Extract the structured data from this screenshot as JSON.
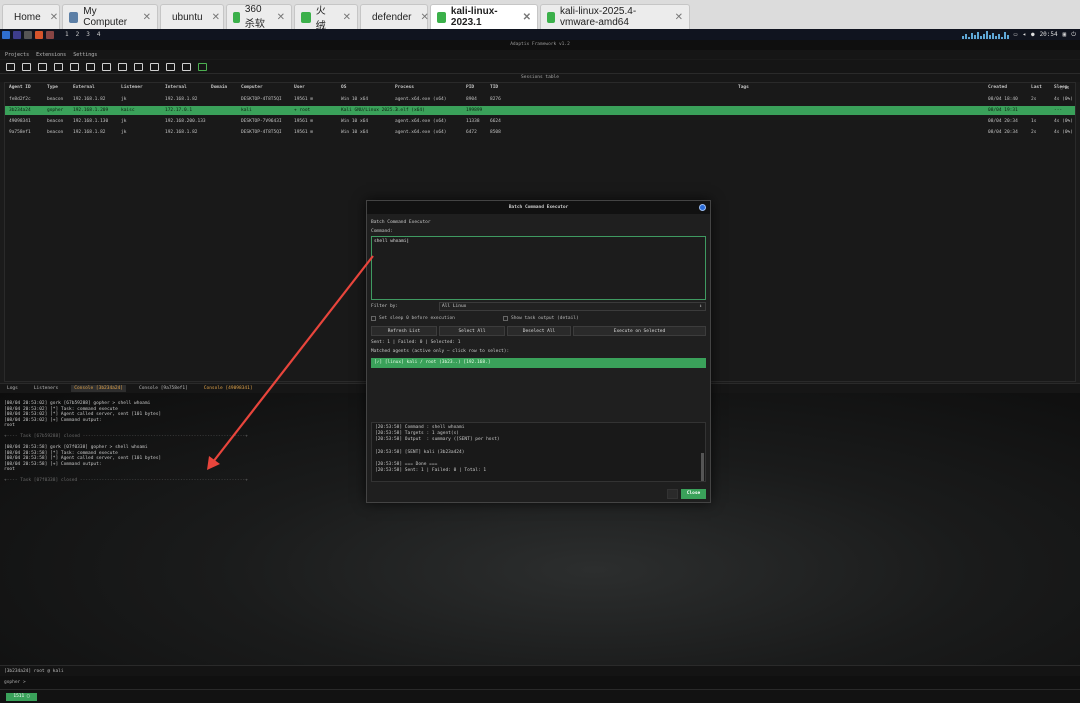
{
  "browser_tabs": [
    {
      "label": "Home",
      "color": "#4a86d8"
    },
    {
      "label": "My Computer",
      "color": "#5c7fa6"
    },
    {
      "label": "ubuntu",
      "color": "#6a8aa8"
    },
    {
      "label": "360杀软",
      "color": "#3bb04a"
    },
    {
      "label": "火绒",
      "color": "#3bb04a"
    },
    {
      "label": "defender",
      "color": "#3bb04a"
    },
    {
      "label": "kali-linux-2023.1",
      "color": "#3bb04a"
    },
    {
      "label": "kali-linux-2025.4-vmware-amd64",
      "color": "#3bb04a"
    }
  ],
  "taskbar": {
    "workspaces": [
      "1",
      "2",
      "3",
      "4"
    ],
    "time": "20:54"
  },
  "app_title": "Adaptix Framework v1.2",
  "menu": [
    "Projects",
    "Extensions",
    "Settings"
  ],
  "sessions": {
    "title": "Sessions table",
    "headers": [
      "Agent ID",
      "Type",
      "External",
      "Listener",
      "Internal",
      "Domain",
      "Computer",
      "User",
      "OS",
      "Process",
      "PID",
      "TID",
      "Tags",
      "Created",
      "Last",
      "Sleep"
    ],
    "rows": [
      [
        "fe8d2f2c",
        "beacon",
        "192.168.1.82",
        "jk",
        "192.168.1.82",
        "",
        "DESKTOP-4T8T5QI",
        "19561 ⊞",
        "Win 10 x64",
        "agent.x64.exe (x64)",
        "8904",
        "8276",
        "",
        "08/04 18:40",
        "2s",
        "4s (0%)"
      ],
      [
        "3b234a24",
        "gopher",
        "192.168.1.209",
        "kaisc",
        "172.17.0.1",
        "",
        "kali",
        "+ root",
        "Kali GNU/Linux 2025.3",
        "3.elf (x64)",
        "199899",
        "",
        "",
        "08/04 19:31",
        "",
        "---"
      ],
      [
        "49098341",
        "beacon",
        "192.168.1.130",
        "jk",
        "192.168.200.133",
        "",
        "DESKTOP-7V9643I",
        "19561 ⊞",
        "Win 10 x64",
        "agent.x64.exe (x64)",
        "11338",
        "6624",
        "",
        "08/04 20:34",
        "1s",
        "4s (0%)"
      ],
      [
        "9a758ef1",
        "beacon",
        "192.168.1.82",
        "jk",
        "192.168.1.82",
        "",
        "DESKTOP-4T8T5QI",
        "19561 ⊞",
        "Win 10 x64",
        "agent.x64.exe (x64)",
        "6472",
        "8508",
        "",
        "08/04 20:34",
        "2s",
        "4s (0%)"
      ]
    ]
  },
  "dialog": {
    "title": "Batch Command Executor",
    "heading": "Batch Command Executor",
    "command_label": "Command:",
    "command_value": "shell whoami",
    "filter_label": "Filter by:",
    "filter_value": "All Linux",
    "sleep_checkbox": "Set sleep 0 before execution",
    "task_output_checkbox": "Show task output (detail)",
    "buttons": {
      "refresh": "Refresh List",
      "select_all": "Select All",
      "deselect_all": "Deselect All",
      "execute": "Execute on Selected",
      "close": "Close"
    },
    "stats": "Sent: 1 | Failed: 0 | Selected: 1",
    "matched_label": "Matched agents (active only — click row to select):",
    "matched_row": "[✓] [linux] kali / root (3b23..)  [192.168.]",
    "log": [
      "[20:53:58] Command : shell whoami",
      "[20:53:58] Targets : 1 agent(s)",
      "[20:53:58] Output  : summary ([SENT] per host)",
      "",
      "[20:53:58] [SENT] kali (3b23a424)",
      "",
      "[20:53:58] === Done ===",
      "[20:53:58] Sent: 1 | Failed: 0 | Total: 1"
    ]
  },
  "bottom_tabs": [
    "Logs",
    "Listeners",
    "Console [3b234a24]",
    "Console [9a758ef1]",
    "Console [49098341]"
  ],
  "console_lines": [
    {
      "t": "[08/04 20:53:02] gork [67b59288] gopher > shell whoami",
      "c": ""
    },
    {
      "t": "[08/04 20:53:02] [*] Task: command execute",
      "c": ""
    },
    {
      "t": "[08/04 20:53:02] [*] Agent called server, sent [101 bytes]",
      "c": ""
    },
    {
      "t": "[08/04 20:53:02] [+] Command output:",
      "c": ""
    },
    {
      "t": "root",
      "c": ""
    },
    {
      "t": "",
      "c": ""
    },
    {
      "t": "+---- Task [67b59288] closed ------------------------------------------------------------+",
      "c": "dim"
    },
    {
      "t": "",
      "c": ""
    },
    {
      "t": "[08/04 20:53:58] gork [07f0338] gopher > shell whoami",
      "c": ""
    },
    {
      "t": "[08/04 20:53:58] [*] Task: command execute",
      "c": ""
    },
    {
      "t": "[08/04 20:53:58] [*] Agent called server, sent [101 bytes]",
      "c": ""
    },
    {
      "t": "[08/04 20:53:58] [+] Command output:",
      "c": ""
    },
    {
      "t": "root",
      "c": ""
    },
    {
      "t": "",
      "c": ""
    },
    {
      "t": "+---- Task [07f0338] closed -------------------------------------------------------------+",
      "c": "dim"
    }
  ],
  "status_line": "[3b234a24] root @ kali",
  "input_prompt": "gopher >",
  "footer_tab": "1511 ▢",
  "accent": "#3aa15a",
  "arrow_color": "#e8453c"
}
